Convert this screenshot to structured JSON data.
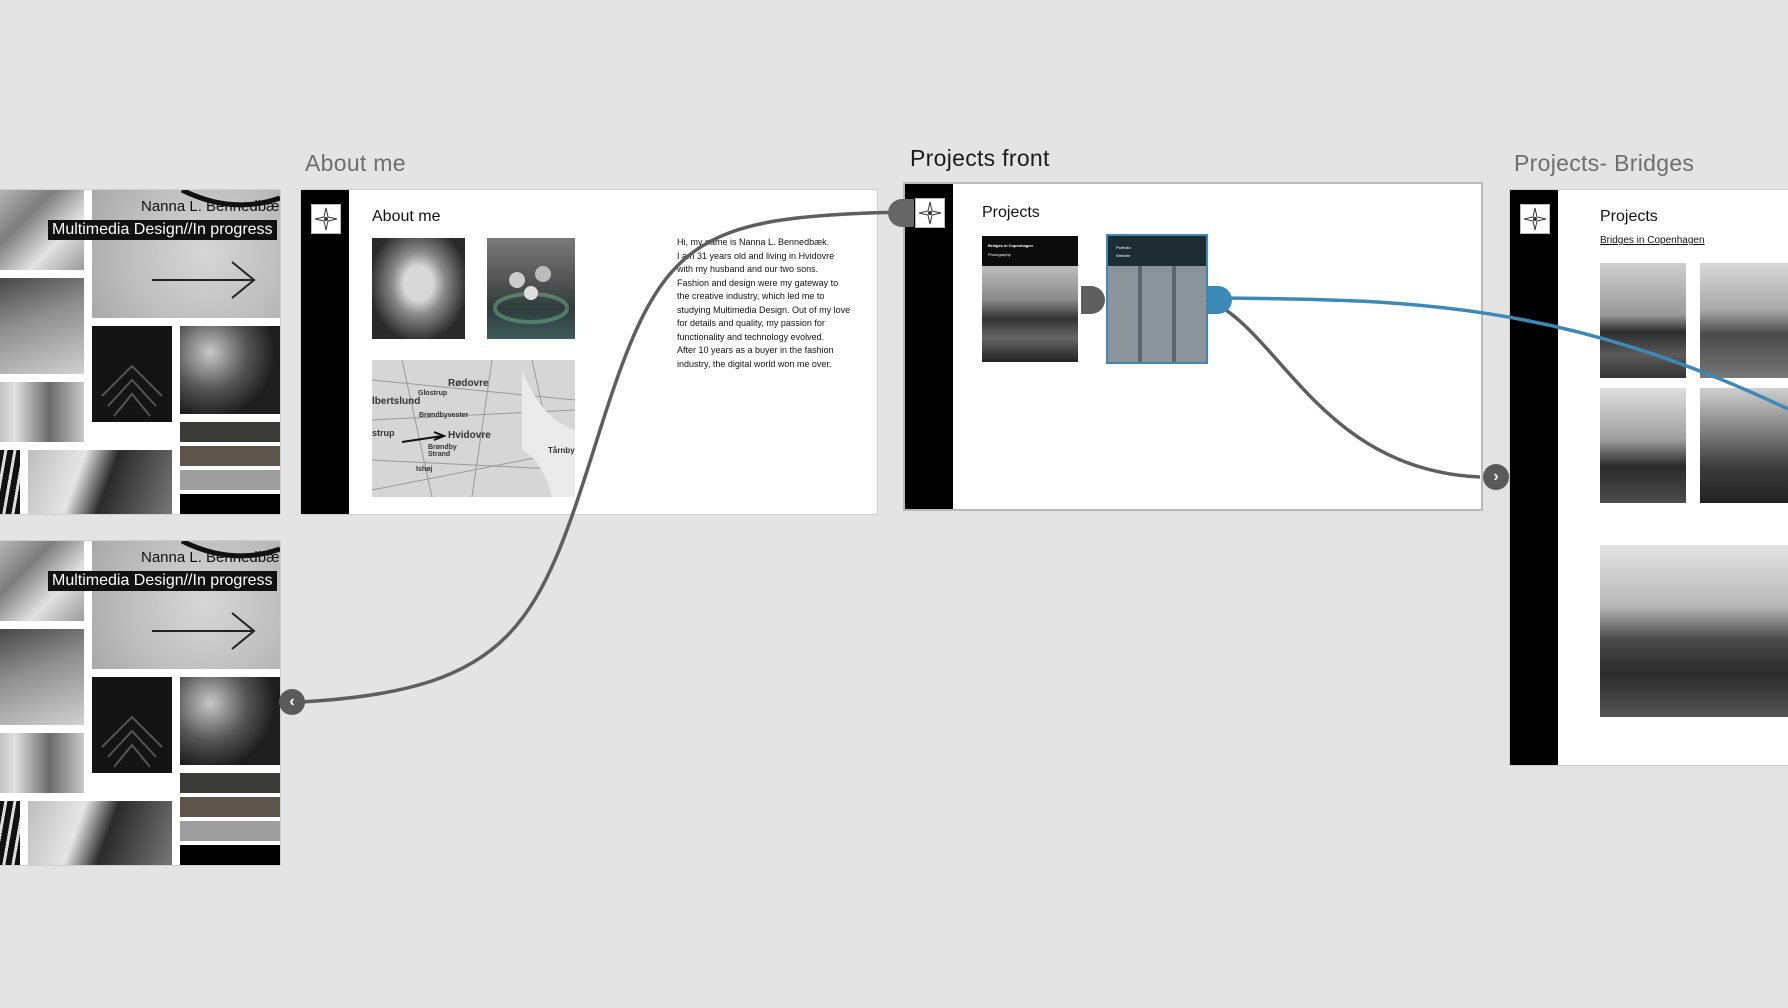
{
  "canvas": {
    "background": "#e4e4e4",
    "wire_color_default": "#5e5e5e",
    "wire_color_selected": "#3d89b6"
  },
  "artboards": {
    "about": {
      "title": "About me",
      "heading": "About me",
      "bio_lines": [
        "Hi, my name is Nanna L. Bennedbæk.",
        "I am 31 years old and living in Hvidovre",
        "with my husband and our two sons.",
        "Fashion and design were my gateway to",
        "the creative industry, which led me to",
        "studying Multimedia Design. Out of my love",
        "for details and quality, my passion for",
        "functionality and technology evolved.",
        "After 10 years as a buyer in the fashion",
        "industry, the digital world won me over."
      ],
      "map_labels": [
        "Rødovre",
        "lbertslund",
        "Glostrup",
        "Brøndbyvester",
        "strup",
        "Hvidovre",
        "Brøndby Strand",
        "Tårnby",
        "Ishøj"
      ]
    },
    "projects_front": {
      "title": "Projects front",
      "heading": "Projects",
      "cards": [
        {
          "title": "Bridges in Copenhagen",
          "subtitle": "Photography"
        },
        {
          "title": "Portfolio",
          "subtitle": "Website"
        }
      ]
    },
    "projects_bridges": {
      "title": "Projects- Bridges",
      "heading": "Projects",
      "link": "Bridges in Copenhagen"
    },
    "home": {
      "name": "Nanna L. Bennedbæk",
      "subtitle": "Multimedia Design//In progress"
    }
  },
  "icons": {
    "back": "chevron-left-icon",
    "forward": "chevron-right-icon",
    "logo": "compass-star-icon"
  }
}
